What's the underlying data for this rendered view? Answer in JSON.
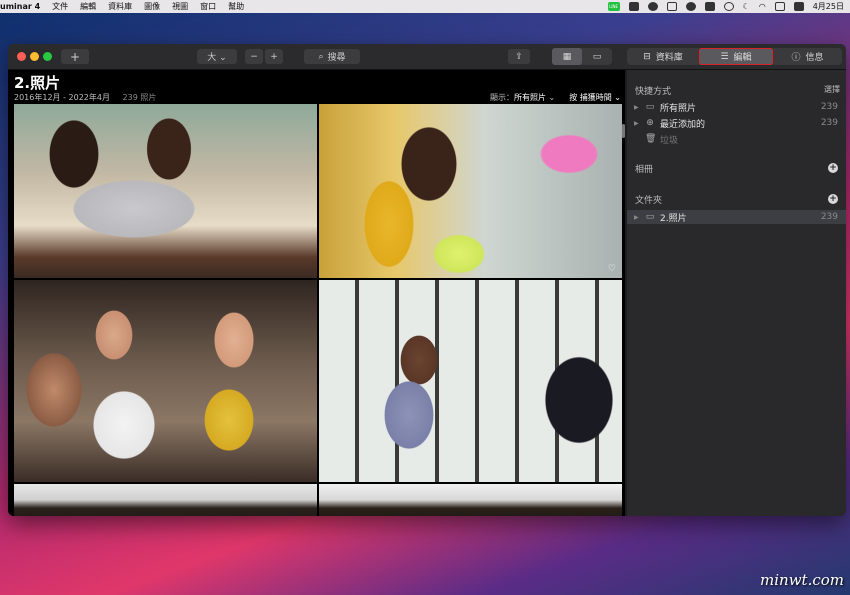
{
  "menubar": {
    "app_name": "uminar 4",
    "items": [
      "文件",
      "編輯",
      "資料庫",
      "圖像",
      "視圖",
      "窗口",
      "幫助"
    ],
    "clock": "4月25日",
    "line_label": "LINE"
  },
  "toolbar": {
    "add_label": "+",
    "size_label": "大 ⌄",
    "minus_label": "−",
    "plus_label": "+",
    "search_label": "搜尋",
    "share_label": "⇪",
    "tab_library": "資料庫",
    "tab_edit": "編輯",
    "tab_info": "信息"
  },
  "gallery": {
    "title": "2.照片",
    "date_range": "2016年12月 - 2022年4月",
    "count": "239 照片",
    "show_label": "顯示：",
    "show_value": "所有照片",
    "sort_value": "按 捕獲時間"
  },
  "sidebar": {
    "shortcuts_title": "快捷方式",
    "select_label": "選擇",
    "shortcuts": [
      {
        "label": "所有照片",
        "count": "239"
      },
      {
        "label": "最近添加的",
        "count": "239"
      },
      {
        "label": "垃圾",
        "count": ""
      }
    ],
    "albums_title": "相冊",
    "folders_title": "文件夾",
    "folders": [
      {
        "label": "2.照片",
        "count": "239"
      }
    ]
  },
  "watermark": "minwt.com",
  "colors": {
    "highlight": "#d8232a",
    "window_bg": "#1d1d1f",
    "sidebar_bg": "#29292b"
  }
}
